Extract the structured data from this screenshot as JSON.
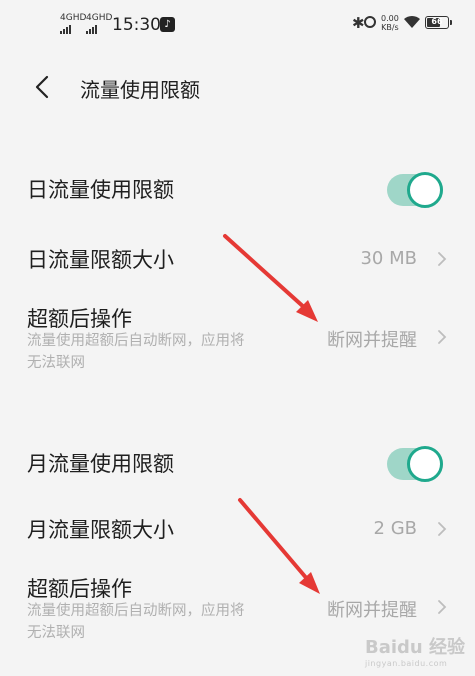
{
  "status_bar": {
    "signal_1": "4GHD",
    "signal_2": "4GHD",
    "time": "15:30",
    "net_speed_value": "0.00",
    "net_speed_unit": "KB/s",
    "battery": "66",
    "battery_level": 0.66,
    "icons": [
      "bluetooth-icon",
      "alarm-icon",
      "wifi-icon",
      "battery-icon",
      "tiktok-icon"
    ]
  },
  "header": {
    "title": "流量使用限额"
  },
  "daily": {
    "limit_toggle_label": "日流量使用限额",
    "limit_toggle_on": true,
    "size_label": "日流量限额大小",
    "size_value": "30 MB",
    "action_label": "超额后操作",
    "action_desc": "流量使用超额后自动断网，应用将无法联网",
    "action_value": "断网并提醒"
  },
  "monthly": {
    "limit_toggle_label": "月流量使用限额",
    "limit_toggle_on": true,
    "size_label": "月流量限额大小",
    "size_value": "2 GB",
    "action_label": "超额后操作",
    "action_desc": "流量使用超额后自动断网，应用将无法联网",
    "action_value": "断网并提醒"
  },
  "watermark": {
    "text": "Baidu 经验",
    "sub": "jingyan.baidu.com"
  },
  "colors": {
    "accent": "#1fa98d",
    "arrow": "#e53935"
  }
}
